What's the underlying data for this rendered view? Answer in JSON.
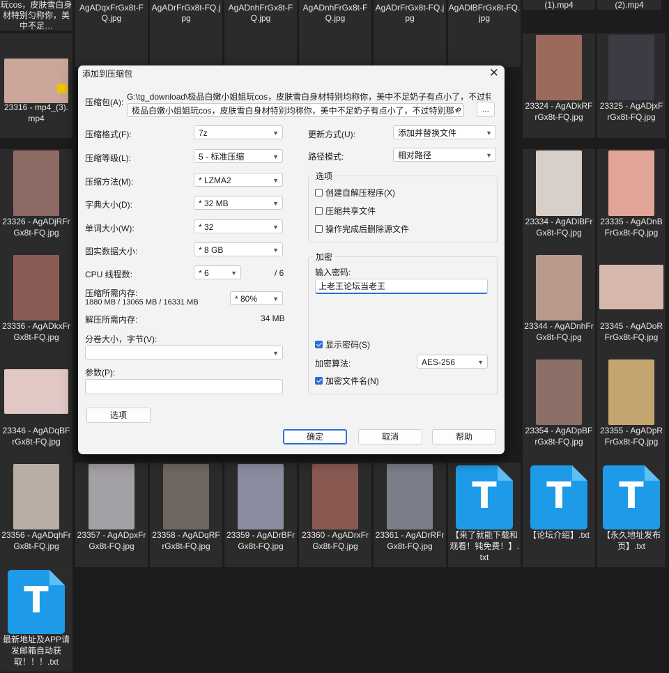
{
  "top_labels": [
    {
      "text": "玩cos，皮肤雪白身材特别匀称你，美中不足…"
    },
    {
      "text": "AgADqxFrGx8t-FQ.jpg"
    },
    {
      "text": "AgADrFrGx8t-FQ.jpg"
    },
    {
      "text": "AgADnhFrGx8t-FQ.jpg"
    },
    {
      "text": "AgADnhFrGx8t-FQ.jpg"
    },
    {
      "text": "AgADrFrGx8t-FQ.jpg"
    },
    {
      "text": "AgADlBFrGx8t-FQ.jpg"
    },
    {
      "text": "(1).mp4"
    },
    {
      "text": "(2).mp4"
    }
  ],
  "tiles": [
    {
      "label": "23316 - mp4_(3).mp4",
      "color": "#c9a59a"
    },
    {
      "label": "23324 - AgADkRFrGx8t-FQ.jpg",
      "color": "#9a6a5c"
    },
    {
      "label": "23325 - AgADjxFrGx8t-FQ.jpg",
      "color": "#3c3c44"
    },
    {
      "label": "23326 - AgADjRFrGx8t-FQ.jpg",
      "color": "#8d6a63"
    },
    {
      "label": "23334 - AgADlBFrGx8t-FQ.jpg",
      "color": "#d8cfc9"
    },
    {
      "label": "23335 - AgADnBFrGx8t-FQ.jpg",
      "color": "#e2a496"
    },
    {
      "label": "23336 - AgADkxFrGx8t-FQ.jpg",
      "color": "#8b5c55"
    },
    {
      "label": "23344 - AgADnhFrGx8t-FQ.jpg",
      "color": "#b89a8c"
    },
    {
      "label": "23345 - AgADoRFrGx8t-FQ.jpg",
      "color": "#d7b8ae"
    },
    {
      "label": "23346 - AgADqBFrGx8t-FQ.jpg",
      "color": "#e2c8c4"
    },
    {
      "label": "23354 - AgADpBFrGx8t-FQ.jpg",
      "color": "#8c7068"
    },
    {
      "label": "23355 - AgADpRFrGx8t-FQ.jpg",
      "color": "#c4a56f"
    },
    {
      "label": "23356 - AgADqhFrGx8t-FQ.jpg",
      "color": "#b8aea6"
    },
    {
      "label": "23357 - AgADpxFrGx8t-FQ.jpg",
      "color": "#a3a0a6"
    },
    {
      "label": "23358 - AgADqRFrGx8t-FQ.jpg",
      "color": "#6e6660"
    },
    {
      "label": "23359 - AgADrBFrGx8t-FQ.jpg",
      "color": "#8b8ca0"
    },
    {
      "label": "23360 - AgADrxFrGx8t-FQ.jpg",
      "color": "#8a5a52"
    },
    {
      "label": "23361 - AgADrRFrGx8t-FQ.jpg",
      "color": "#7a7e88"
    }
  ],
  "txt_files": [
    {
      "label": "【来了就能下载和观看！钝免费！】.txt"
    },
    {
      "label": "【论坛介绍】.txt"
    },
    {
      "label": "【永久地址发布页】.txt"
    },
    {
      "label": "最新地址及APP请发邮箱自动获取！！！.txt"
    }
  ],
  "txt_icon_letter": "T",
  "dialog": {
    "title": "添加到压缩包",
    "close": "✕",
    "archive_label": "压缩包(A):",
    "archive_path": "G:\\tg_download\\极品白嫩小姐姐玩cos，皮肤雪白身材特别均称你，美中不足奶子有点小了，不过特别",
    "archive_name": "极品白嫩小姐姐玩cos，皮肤雪白身材特别均称你，美中不足奶子有点小了，不过特别那 ?",
    "browse": "...",
    "rows_left": [
      {
        "label": "压缩格式(F):",
        "value": "7z"
      },
      {
        "label": "压缩等级(L):",
        "value": "5 - 标准压缩"
      },
      {
        "label": "压缩方法(M):",
        "value": "* LZMA2"
      },
      {
        "label": "字典大小(D):",
        "value": "* 32 MB"
      },
      {
        "label": "单词大小(W):",
        "value": "* 32"
      },
      {
        "label": "固实数据大小:",
        "value": "* 8 GB"
      }
    ],
    "cpu_label": "CPU 线程数:",
    "cpu_value": "* 6",
    "cpu_total": "/ 6",
    "mem_comp_label": "压缩所需内存:",
    "mem_comp_values": "1880 MB / 13065 MB / 16331 MB",
    "mem_comp_percent": "* 80%",
    "mem_decomp_label": "解压所需内存:",
    "mem_decomp_value": "34 MB",
    "split_label": "分卷大小，字节(V):",
    "split_value": "",
    "params_label": "参数(P):",
    "params_value": "",
    "options_button": "选项",
    "update_label": "更新方式(U):",
    "update_value": "添加并替换文件",
    "path_label": "路径模式:",
    "path_value": "相对路径",
    "options_group": "选项",
    "options": [
      {
        "label": "创建自解压程序(X)",
        "checked": false
      },
      {
        "label": "压缩共享文件",
        "checked": false
      },
      {
        "label": "操作完成后删除源文件",
        "checked": false
      }
    ],
    "encrypt_group": "加密",
    "password_label": "输入密码:",
    "password_value": "上老王论坛当老王",
    "show_password": {
      "label": "显示密码(S)",
      "checked": true
    },
    "enc_method_label": "加密算法:",
    "enc_method_value": "AES-256",
    "encrypt_names": {
      "label": "加密文件名(N)",
      "checked": true
    },
    "ok": "确定",
    "cancel": "取消",
    "help": "帮助"
  }
}
